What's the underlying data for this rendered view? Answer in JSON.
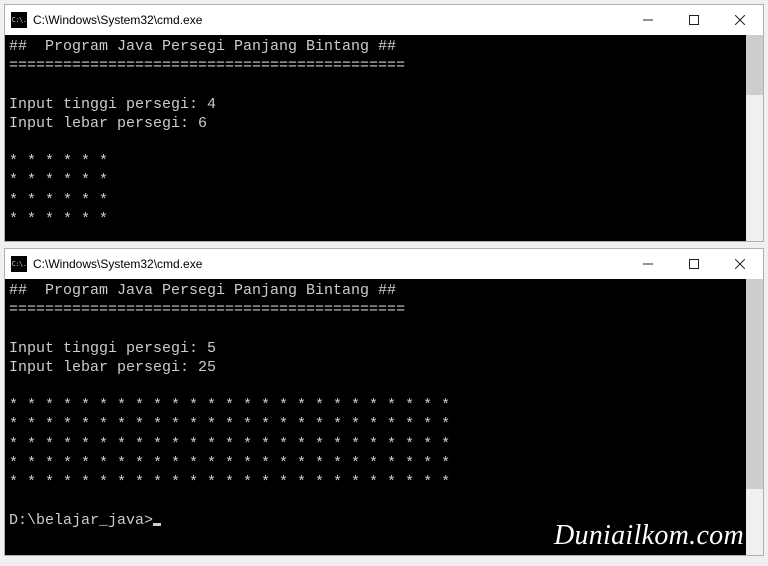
{
  "windows": [
    {
      "title": "C:\\Windows\\System32\\cmd.exe",
      "icon_label": "C:\\.",
      "header": "##  Program Java Persegi Panjang Bintang ##",
      "divider": "============================================",
      "prompt_tinggi": "Input tinggi persegi: ",
      "tinggi": "4",
      "prompt_lebar": "Input lebar persegi: ",
      "lebar": "6",
      "rows": [
        "* * * * * *",
        "* * * * * *",
        "* * * * * *",
        "* * * * * *"
      ],
      "show_prompt": false,
      "scroll_thumb_top": 0,
      "scroll_thumb_height": 60
    },
    {
      "title": "C:\\Windows\\System32\\cmd.exe",
      "icon_label": "C:\\.",
      "header": "##  Program Java Persegi Panjang Bintang ##",
      "divider": "============================================",
      "prompt_tinggi": "Input tinggi persegi: ",
      "tinggi": "5",
      "prompt_lebar": "Input lebar persegi: ",
      "lebar": "25",
      "rows": [
        "* * * * * * * * * * * * * * * * * * * * * * * * *",
        "* * * * * * * * * * * * * * * * * * * * * * * * *",
        "* * * * * * * * * * * * * * * * * * * * * * * * *",
        "* * * * * * * * * * * * * * * * * * * * * * * * *",
        "* * * * * * * * * * * * * * * * * * * * * * * * *"
      ],
      "show_prompt": true,
      "cmd_prompt": "D:\\belajar_java>",
      "scroll_thumb_top": 0,
      "scroll_thumb_height": 210
    }
  ],
  "watermark": "Duniailkom.com"
}
